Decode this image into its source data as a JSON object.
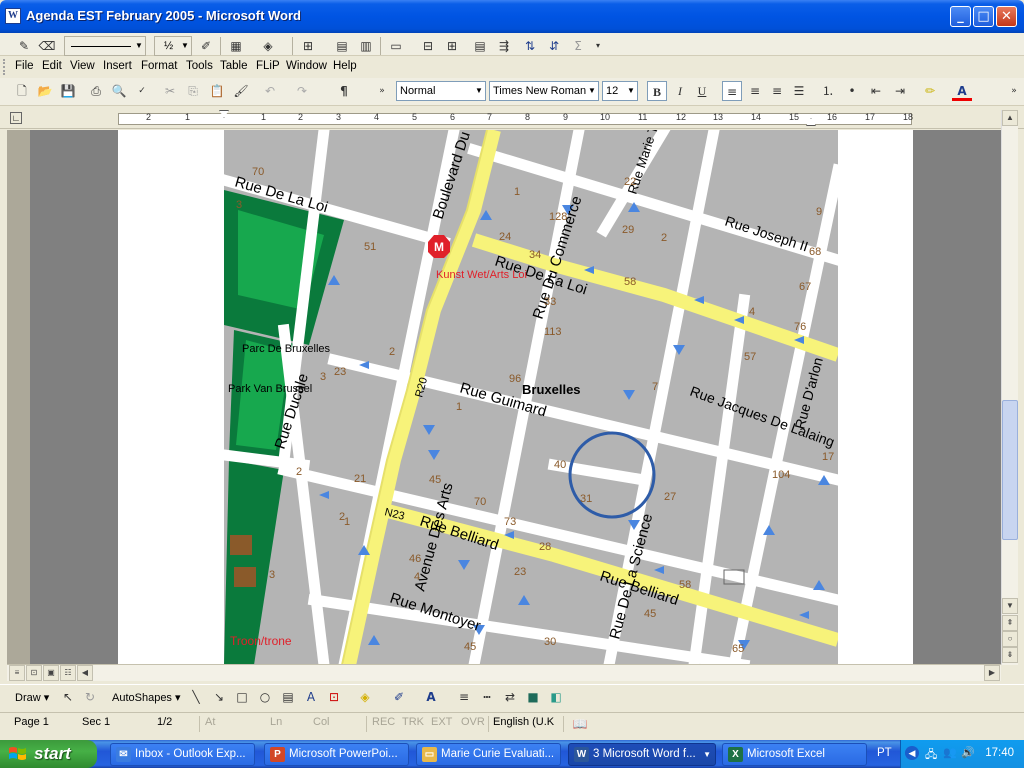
{
  "window": {
    "title": "Agenda EST February 2005 - Microsoft Word",
    "app_icon": "W"
  },
  "draw_toolbar_top": {
    "line_width": "½"
  },
  "menu": [
    "File",
    "Edit",
    "View",
    "Insert",
    "Format",
    "Tools",
    "Table",
    "FLiP",
    "Window",
    "Help"
  ],
  "formatting": {
    "style": "Normal",
    "font": "Times New Roman",
    "size": "12"
  },
  "ruler": {
    "numbers": [
      "2",
      "1",
      "1",
      "2",
      "3",
      "4",
      "5",
      "6",
      "7",
      "8",
      "9",
      "10",
      "11",
      "12",
      "13",
      "14",
      "15",
      "16",
      "17",
      "18"
    ]
  },
  "map": {
    "streets": {
      "rue_de_la_loi_w": "Rue De La Loi",
      "boulevard_regent": "Boulevard Du Regent",
      "rue_de_la_loi_e": "Rue De La Loi",
      "rue_du_commerce": "Rue Du Commerce",
      "rue_marie_therese": "Rue Marie Therese",
      "rue_joseph_ii": "Rue Joseph II",
      "rue_ducale": "Rue Ducale",
      "avenue_des_arts": "Avenue Des Arts",
      "rue_guimard": "Rue Guimard",
      "rue_jacques_de_lalaing": "Rue Jacques De Lalaing",
      "rue_d_arlon": "Rue D'arlon",
      "rue_belliard": "Rue Belliard",
      "rue_belliard_e": "Rue Belliard",
      "rue_montoyer": "Rue Montoyer",
      "rue_de_la_science": "Rue De La Science",
      "r20": "R20",
      "n23": "N23"
    },
    "places": {
      "metro": "M",
      "kunst_wet": "Kunst Wet/Arts Loi",
      "parc_de_bruxelles": "Parc De Bruxelles",
      "park_van_brussel": "Park Van Brussel",
      "bruxelles": "Bruxelles",
      "troon": "Troon/trone"
    },
    "house_numbers": [
      "70",
      "3",
      "51",
      "24",
      "34",
      "1",
      "128",
      "29",
      "2",
      "22",
      "9",
      "68",
      "33",
      "58",
      "4",
      "67",
      "76",
      "113",
      "2",
      "57",
      "7",
      "23",
      "3",
      "2",
      "96",
      "1",
      "17",
      "104",
      "40",
      "27",
      "21",
      "45",
      "70",
      "73",
      "31",
      "2",
      "1",
      "46",
      "4",
      "23",
      "28",
      "58",
      "45",
      "45",
      "30",
      "65",
      "3"
    ]
  },
  "draw_bar": {
    "draw": "Draw",
    "autoshapes": "AutoShapes"
  },
  "status": {
    "page": "Page 1",
    "sec": "Sec 1",
    "pages": "1/2",
    "at": "At",
    "ln": "Ln",
    "col": "Col",
    "rec": "REC",
    "trk": "TRK",
    "ext": "EXT",
    "ovr": "OVR",
    "language": "English (U.K"
  },
  "taskbar": {
    "start": "start",
    "tasks": [
      "Inbox - Outlook Exp...",
      "Microsoft PowerPoi...",
      "Marie Curie Evaluati...",
      "3 Microsoft Word f...",
      "Microsoft Excel"
    ],
    "lang": "PT",
    "clock": "17:40"
  },
  "colors": {
    "road_major": "#F7F37A",
    "road": "#FFFFFF",
    "block": "#B4B4B4",
    "park": "#0A7A3C",
    "arrow": "#4A86E0",
    "metro": "#E0202A",
    "circle": "#2E5CA8"
  }
}
